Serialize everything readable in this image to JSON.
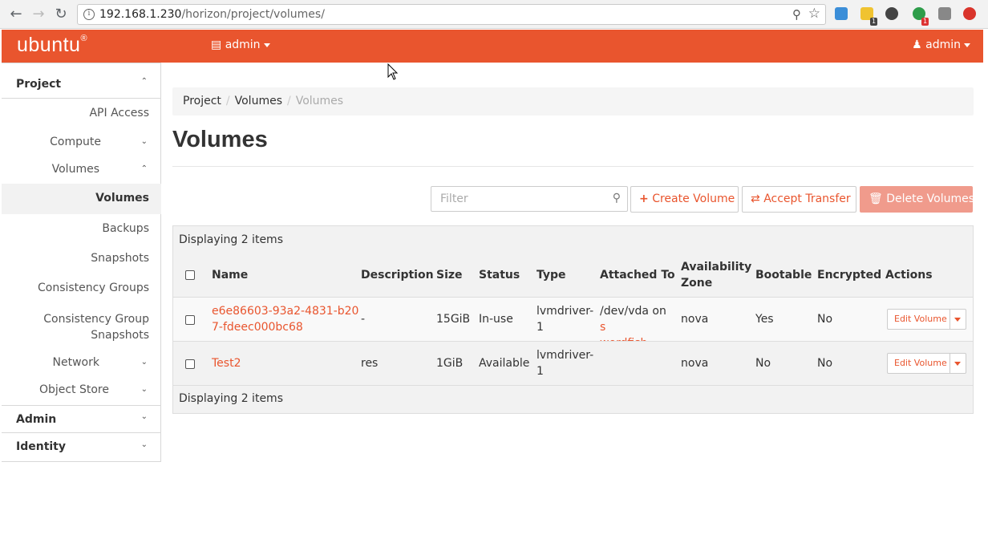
{
  "browser": {
    "url_host": "192.168.1.230",
    "url_path": "/horizon/project/volumes/",
    "ext_badges": [
      "1",
      "1"
    ]
  },
  "navbar": {
    "brand": "ubuntu",
    "brand_mark": "®",
    "project_label": "admin",
    "user_label": "admin"
  },
  "sidebar": {
    "project": "Project",
    "api_access": "API Access",
    "compute": "Compute",
    "volumes_group": "Volumes",
    "volumes": "Volumes",
    "backups": "Backups",
    "snapshots": "Snapshots",
    "consistency_groups": "Consistency Groups",
    "cg_snapshots_1": "Consistency Group",
    "cg_snapshots_2": "Snapshots",
    "network": "Network",
    "object_store": "Object Store",
    "admin": "Admin",
    "identity": "Identity"
  },
  "breadcrumb": [
    "Project",
    "Volumes",
    "Volumes"
  ],
  "page_title": "Volumes",
  "toolbar": {
    "filter_placeholder": "Filter",
    "create_volume": "Create Volume",
    "accept_transfer": "Accept Transfer",
    "delete_volumes": "Delete Volumes"
  },
  "table": {
    "summary_top": "Displaying 2 items",
    "summary_bottom": "Displaying 2 items",
    "headers": {
      "name": "Name",
      "description": "Description",
      "size": "Size",
      "status": "Status",
      "type": "Type",
      "attached_to": "Attached To",
      "availability_zone_1": "Availability",
      "availability_zone_2": "Zone",
      "bootable": "Bootable",
      "encrypted": "Encrypted",
      "actions": "Actions"
    },
    "rows": [
      {
        "name_1": "e6e86603-93a2-4831-b20",
        "name_2": "7-fdeec000bc68",
        "description": "-",
        "size": "15GiB",
        "status": "In-use",
        "type_1": "lvmdriver-",
        "type_2": "1",
        "attached_prefix": "/dev/vda on ",
        "attached_link_1": "s",
        "attached_link_2": "wordfish",
        "zone": "nova",
        "bootable": "Yes",
        "encrypted": "No",
        "action": "Edit Volume"
      },
      {
        "name_1": "Test2",
        "name_2": "",
        "description": "res",
        "size": "1GiB",
        "status": "Available",
        "type_1": "lvmdriver-",
        "type_2": "1",
        "attached_prefix": "",
        "attached_link_1": "",
        "attached_link_2": "",
        "zone": "nova",
        "bootable": "No",
        "encrypted": "No",
        "action": "Edit Volume"
      }
    ]
  },
  "colors": {
    "accent": "#e9552e",
    "danger_disabled": "#f09b8c"
  }
}
